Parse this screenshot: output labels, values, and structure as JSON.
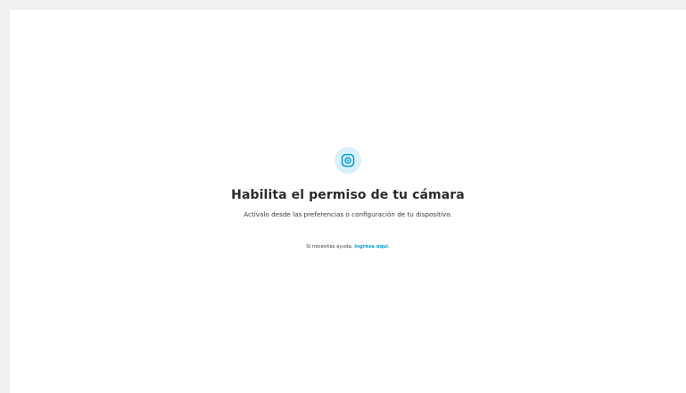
{
  "page": {
    "icon": "camera-icon",
    "accent_color": "#0a9be0",
    "badge_color": "#d9f0fd"
  },
  "main": {
    "title": "Habilita el permiso de tu cámara",
    "subtitle": "Actívalo desde las preferencias o configuración de tu dispositivo.",
    "help_prefix": "Si necesitas ayuda, ",
    "help_link": "ingresa aquí",
    "help_suffix": "."
  }
}
